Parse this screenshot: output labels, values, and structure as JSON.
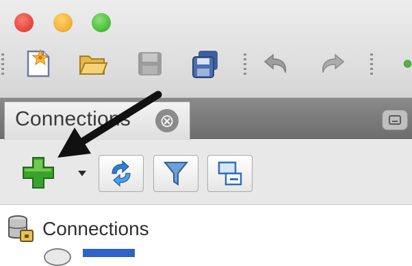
{
  "window": {
    "traffic_lights": [
      "close",
      "minimize",
      "zoom"
    ]
  },
  "toolbar": {
    "buttons": [
      {
        "icon": "new-file-icon"
      },
      {
        "icon": "open-folder-icon"
      },
      {
        "icon": "save-icon"
      },
      {
        "icon": "save-all-icon"
      },
      {
        "icon": "undo-icon"
      },
      {
        "icon": "redo-icon"
      },
      {
        "icon": "run-icon"
      }
    ]
  },
  "tabs": {
    "connections_tab": {
      "label": "Connections",
      "close_glyph": "⊗"
    },
    "strip_control_icon": "minimize-window-icon"
  },
  "panel_toolbar": {
    "buttons": [
      {
        "icon": "add-connection-plus-icon"
      },
      {
        "icon": "dropdown-caret-icon"
      },
      {
        "icon": "refresh-icon"
      },
      {
        "icon": "filter-funnel-icon"
      },
      {
        "icon": "collapse-all-icon"
      }
    ]
  },
  "tree": {
    "root": {
      "label": "Connections",
      "icon": "database-connections-icon"
    }
  },
  "annotation": {
    "type": "pointer-arrow",
    "color": "#111111",
    "points_to": "add-connection-plus-icon"
  },
  "colors": {
    "plus_green": "#3aa12c",
    "selection_blue": "#2f62c9",
    "accent_blue": "#2d7fd0"
  }
}
